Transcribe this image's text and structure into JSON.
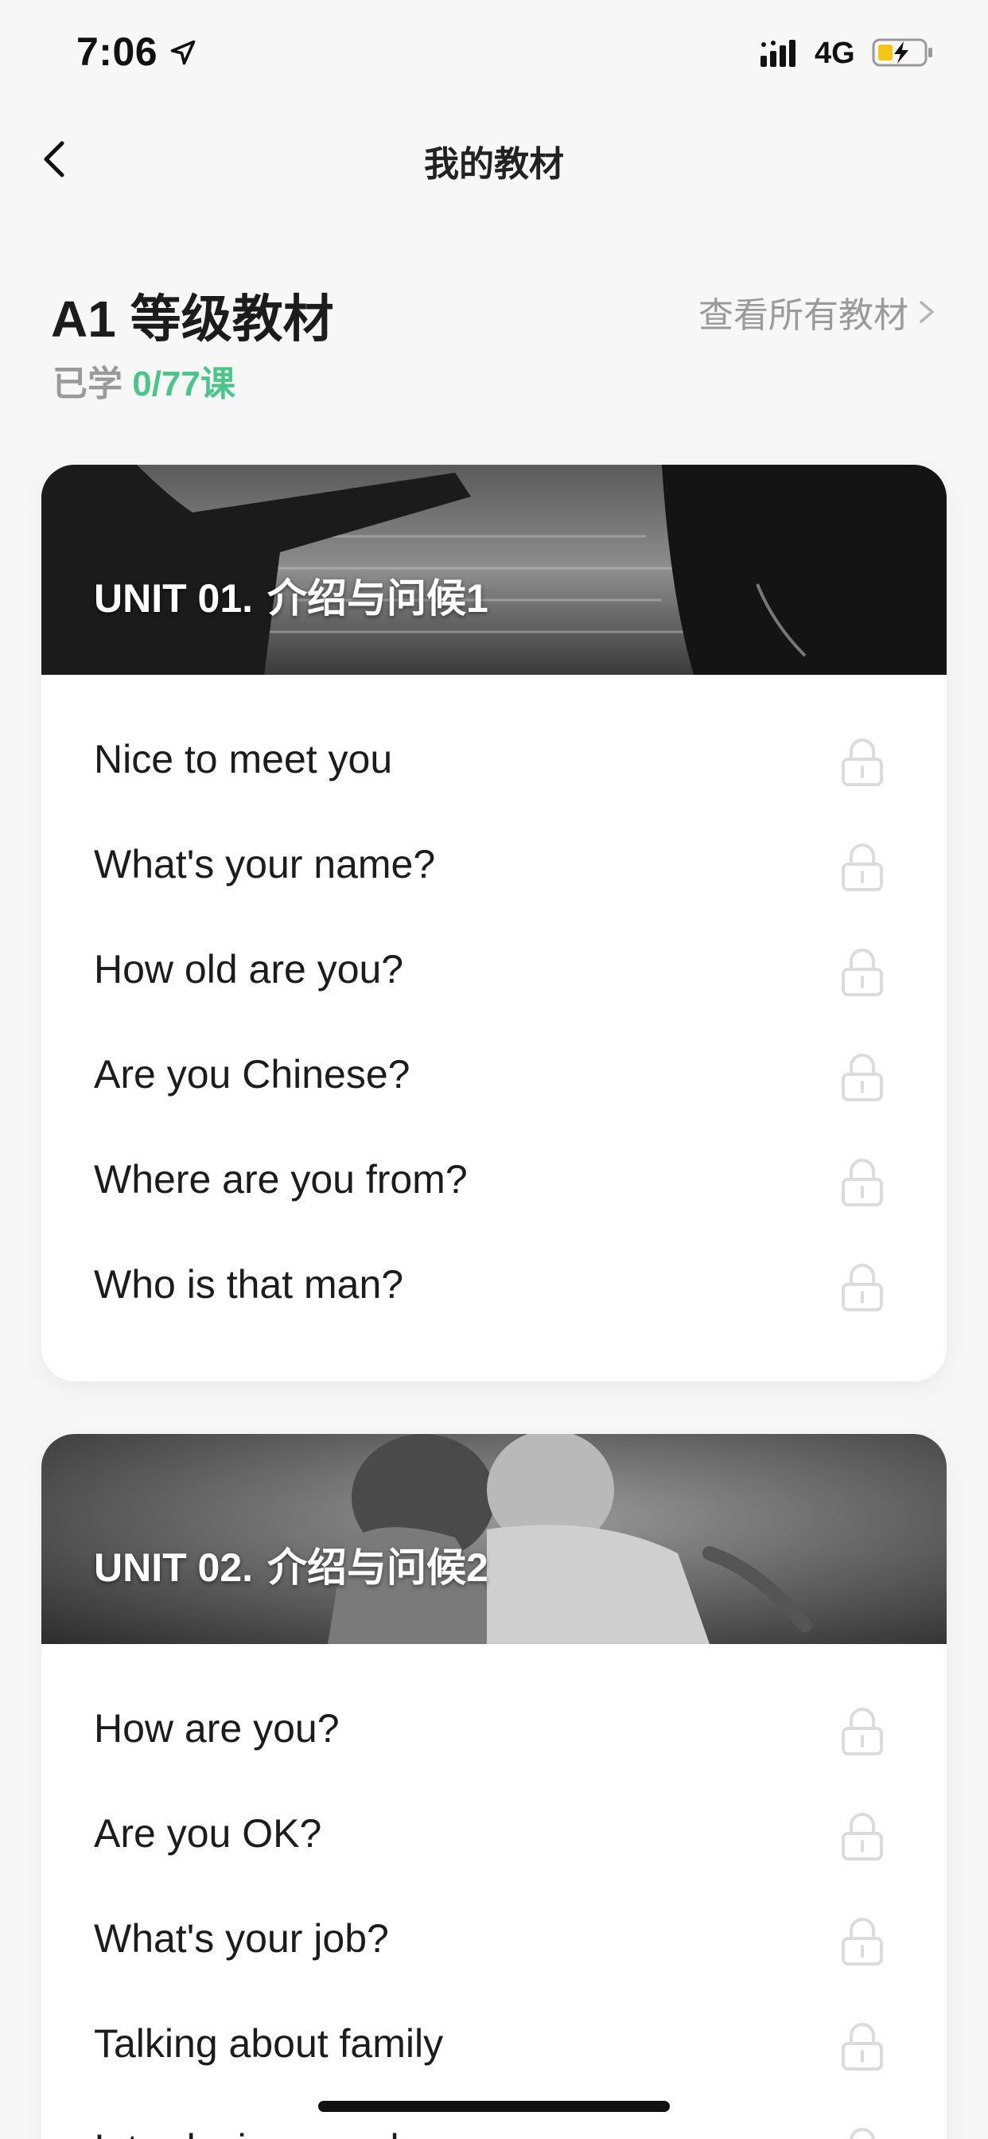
{
  "status_bar": {
    "time": "7:06",
    "network": "4G",
    "icons": [
      "location-arrow-icon",
      "signal-icon",
      "battery-charging-icon"
    ]
  },
  "nav": {
    "title": "我的教材",
    "back_icon": "chevron-left-icon"
  },
  "header": {
    "level_title": "A1 等级教材",
    "view_all_label": "查看所有教材",
    "progress_label": "已学",
    "progress_value": "0/77课"
  },
  "colors": {
    "accent_green": "#4cc58a",
    "muted_text": "#9a9a9a",
    "lock_gray": "#dcdcdc"
  },
  "units": [
    {
      "code": "UNIT 01.",
      "title": "介绍与问候1",
      "lessons": [
        {
          "title": "Nice to meet you",
          "locked": true
        },
        {
          "title": "What's your name?",
          "locked": true
        },
        {
          "title": "How old are you?",
          "locked": true
        },
        {
          "title": "Are you Chinese?",
          "locked": true
        },
        {
          "title": "Where are you from?",
          "locked": true
        },
        {
          "title": "Who is that man?",
          "locked": true
        }
      ]
    },
    {
      "code": "UNIT 02.",
      "title": "介绍与问候2",
      "lessons": [
        {
          "title": "How are you?",
          "locked": true
        },
        {
          "title": "Are you OK?",
          "locked": true
        },
        {
          "title": "What's your job?",
          "locked": true
        },
        {
          "title": "Talking about family",
          "locked": true
        },
        {
          "title": "Introducing people",
          "locked": true
        }
      ]
    }
  ]
}
